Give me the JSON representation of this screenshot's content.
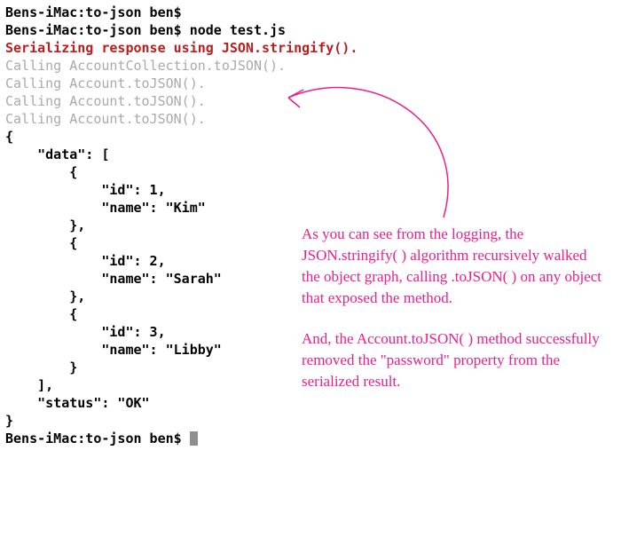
{
  "terminal": {
    "prompt1": "Bens-iMac:to-json ben$",
    "prompt2_prefix": "Bens-iMac:to-json ben$ ",
    "command": "node test.js",
    "red_line_a": "Serializing response using ",
    "red_line_b": "JSON.stringify()",
    "red_line_c": ".",
    "grey1": "Calling AccountCollection.toJSON().",
    "grey2": "Calling Account.toJSON().",
    "grey3": "Calling Account.toJSON().",
    "grey4": "Calling Account.toJSON().",
    "json": "{\n    \"data\": [\n        {\n            \"id\": 1,\n            \"name\": \"Kim\"\n        },\n        {\n            \"id\": 2,\n            \"name\": \"Sarah\"\n        },\n        {\n            \"id\": 3,\n            \"name\": \"Libby\"\n        }\n    ],\n    \"status\": \"OK\"\n}",
    "prompt3": "Bens-iMac:to-json ben$ "
  },
  "annotation": {
    "p1": "As you can see from the logging, the JSON.stringify( ) algorithm recursively walked the object graph, calling .toJSON( ) on any object that exposed the method.",
    "p2": "And, the Account.toJSON( ) method successfully removed the \"password\" property from the serialized result."
  }
}
